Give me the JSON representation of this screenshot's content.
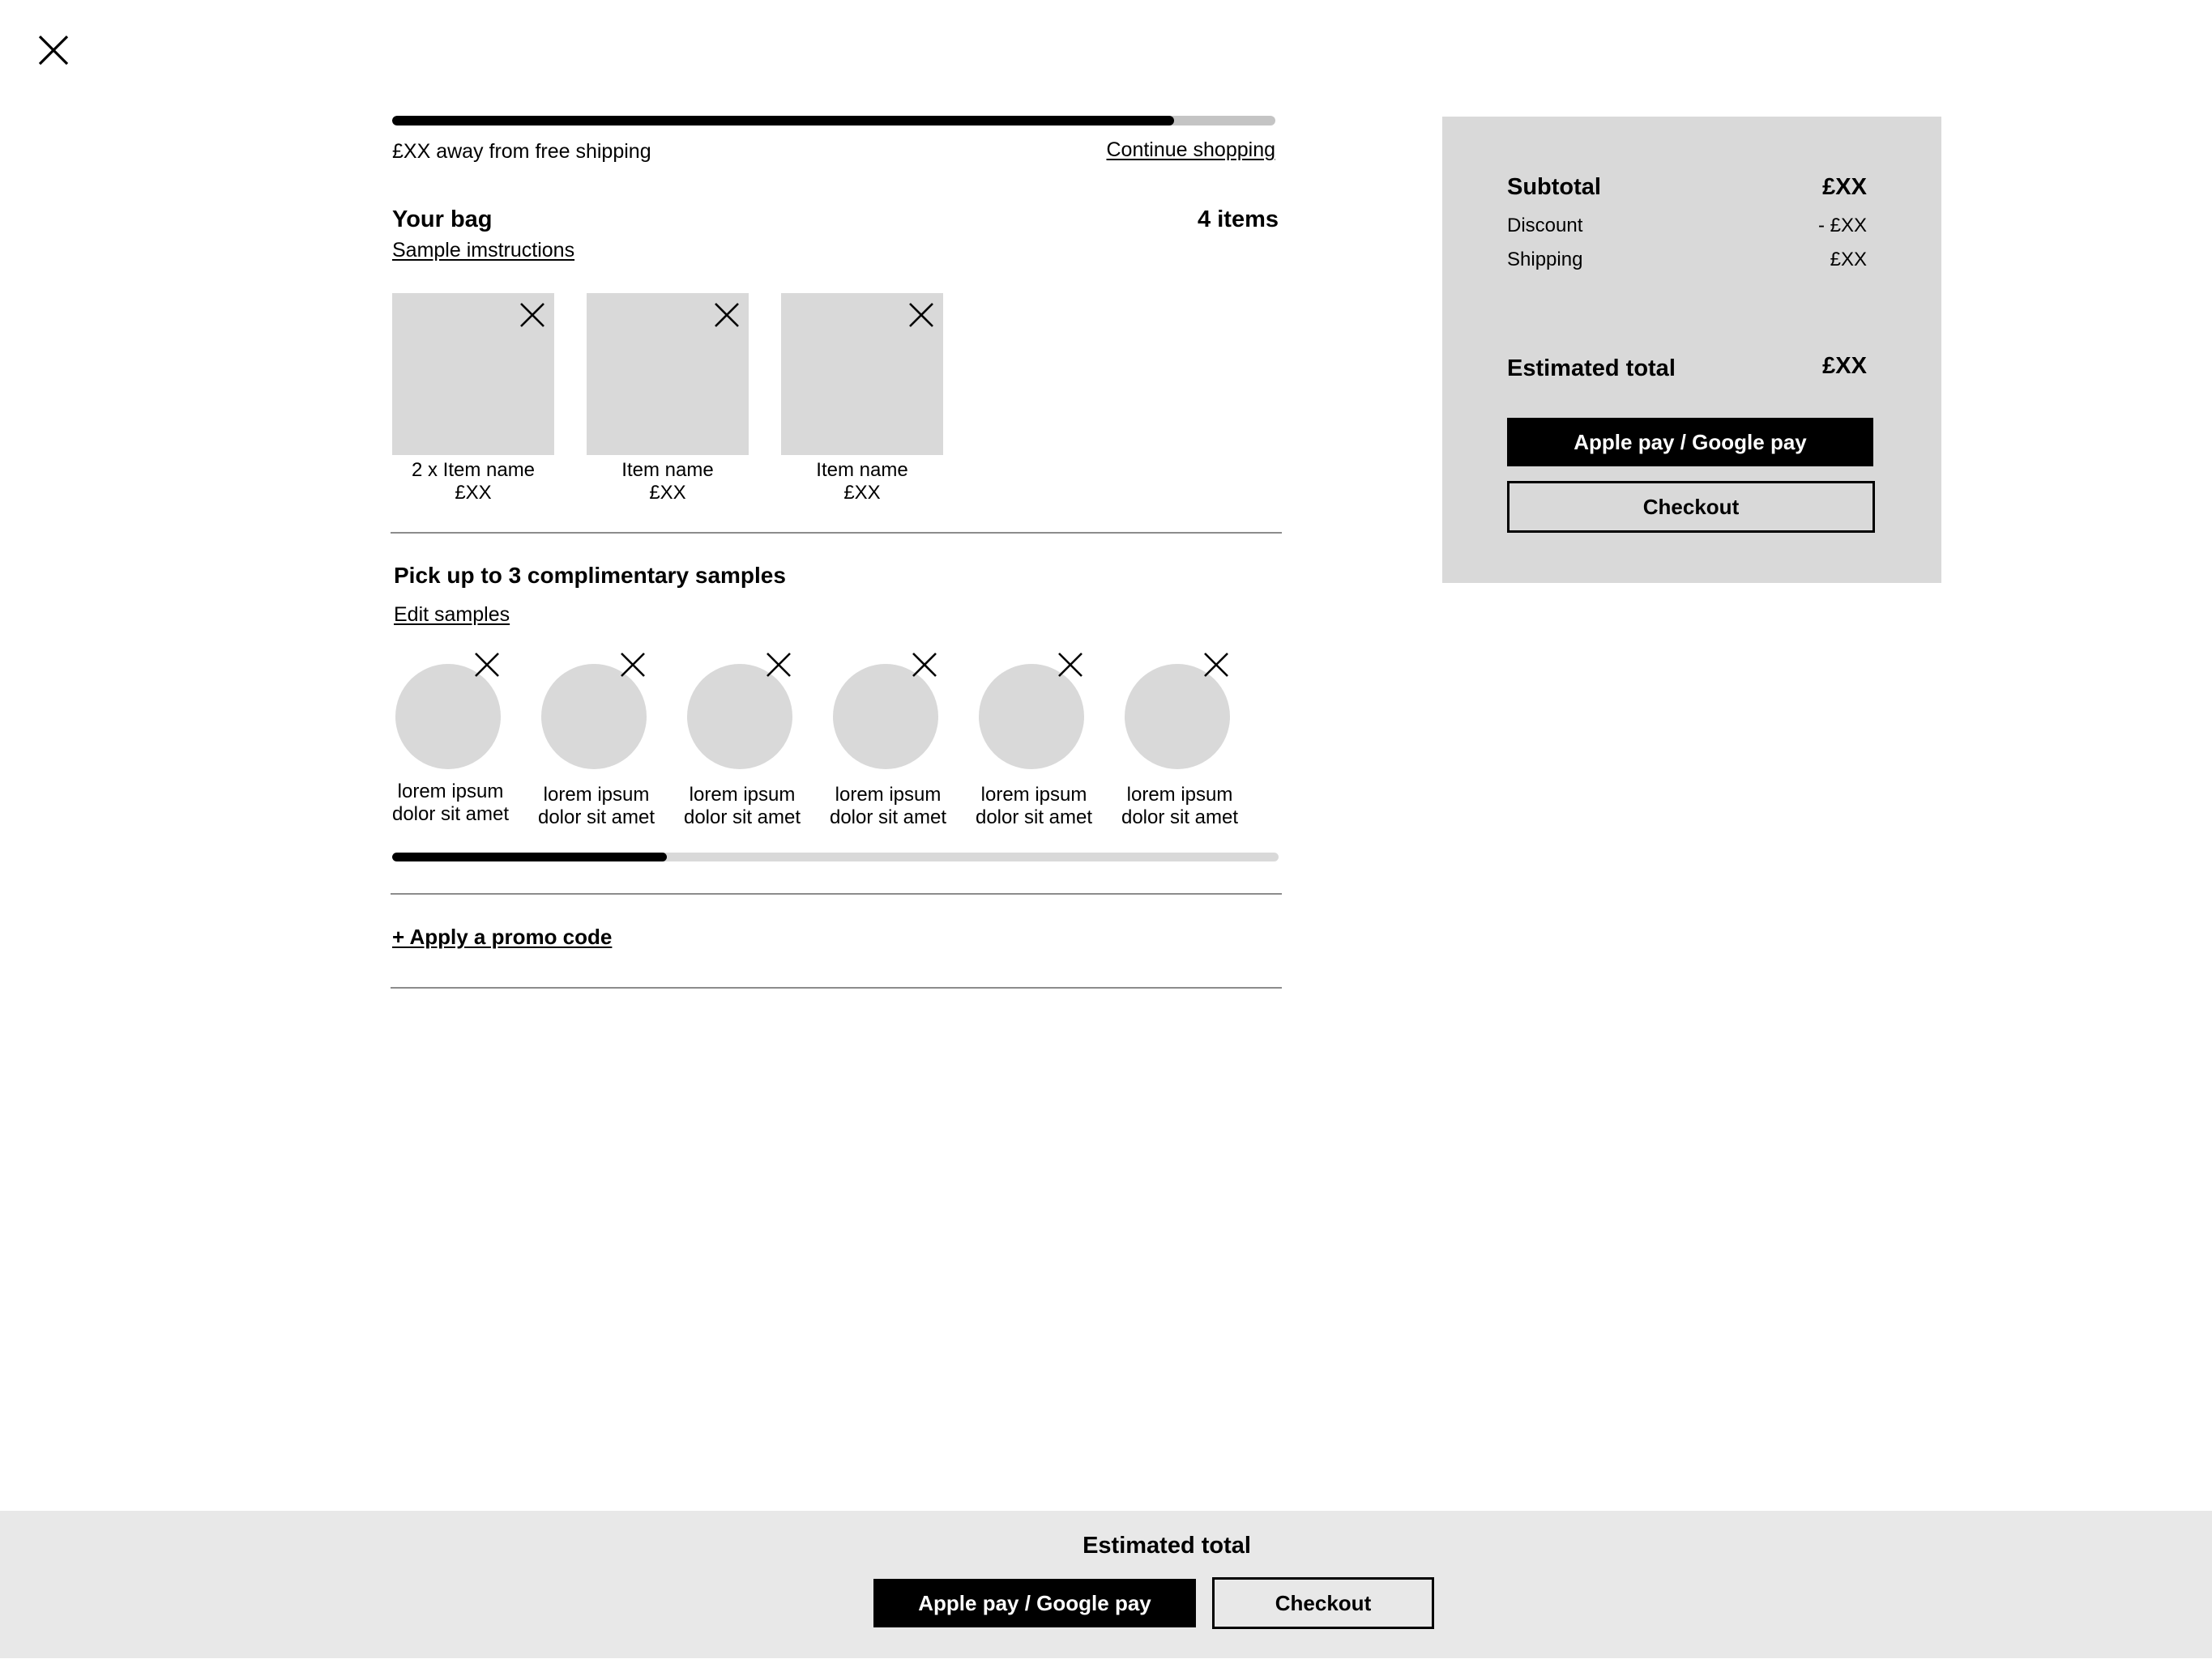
{
  "shipping": {
    "progress_fraction": 0.885,
    "message": "£XX away from free shipping",
    "continue_label": "Continue shopping"
  },
  "bag": {
    "title": "Your bag",
    "count": "4 items",
    "sample_instructions": "Sample imstructions",
    "items": [
      {
        "name": "2 x Item name",
        "price": "£XX"
      },
      {
        "name": "Item name",
        "price": "£XX"
      },
      {
        "name": "Item name",
        "price": "£XX"
      }
    ]
  },
  "samples": {
    "title": "Pick up to 3 complimentary samples",
    "edit_label": "Edit samples",
    "items": [
      {
        "line1": "lorem ipsum",
        "line2": "dolor sit amet"
      },
      {
        "line1": "lorem ipsum",
        "line2": "dolor sit amet"
      },
      {
        "line1": "lorem ipsum",
        "line2": "dolor sit amet"
      },
      {
        "line1": "lorem ipsum",
        "line2": "dolor sit amet"
      },
      {
        "line1": "lorem ipsum",
        "line2": "dolor sit amet"
      },
      {
        "line1": "lorem ipsum",
        "line2": "dolor sit amet"
      }
    ],
    "scroll_fraction": 0.31
  },
  "promo": {
    "label": "+ Apply a promo code"
  },
  "summary": {
    "subtotal_label": "Subtotal",
    "subtotal_value": "£XX",
    "discount_label": "Discount",
    "discount_value": "- £XX",
    "shipping_label": "Shipping",
    "shipping_value": "£XX",
    "estimated_label": "Estimated total",
    "estimated_value": "£XX",
    "pay_label": "Apple pay / Google pay",
    "checkout_label": "Checkout"
  },
  "footer": {
    "estimated_label": "Estimated total",
    "pay_label": "Apple pay / Google pay",
    "checkout_label": "Checkout"
  },
  "icons": {
    "close": "close-icon",
    "remove": "remove-x-icon"
  },
  "colors": {
    "placeholder_gray": "#d9d9d9",
    "summary_bg": "#d9d9d9",
    "footer_bg": "#e8e8e8",
    "track_gray": "#c4c4c4",
    "accent": "#000000"
  }
}
